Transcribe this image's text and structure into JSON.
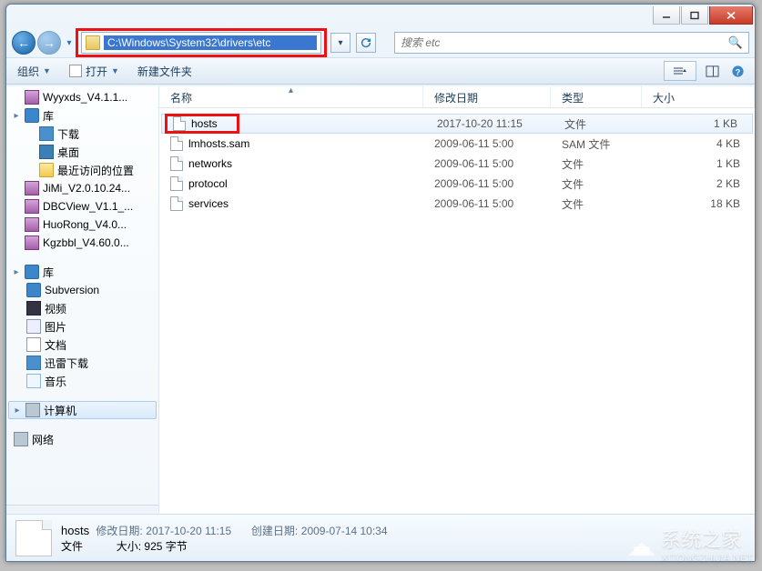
{
  "window": {
    "title": ""
  },
  "nav": {
    "address_path": "C:\\Windows\\System32\\drivers\\etc",
    "search_placeholder": "搜索 etc"
  },
  "toolbar": {
    "organize": "组织",
    "open": "打开",
    "new_folder": "新建文件夹"
  },
  "columns": {
    "name": "名称",
    "date": "修改日期",
    "type": "类型",
    "size": "大小"
  },
  "sidebar": {
    "items": [
      {
        "icon": "archive",
        "label": "Wyyxds_V4.1.1..."
      },
      {
        "icon": "lib",
        "label": "库",
        "twist": "▸"
      },
      {
        "icon": "dl",
        "label": "下载",
        "depth": 1
      },
      {
        "icon": "desktop",
        "label": "桌面",
        "depth": 1
      },
      {
        "icon": "folder",
        "label": "最近访问的位置",
        "depth": 1
      },
      {
        "icon": "archive",
        "label": "JiMi_V2.0.10.24..."
      },
      {
        "icon": "archive",
        "label": "DBCView_V1.1_..."
      },
      {
        "icon": "archive",
        "label": "HuoRong_V4.0..."
      },
      {
        "icon": "archive",
        "label": "Kgzbbl_V4.60.0..."
      }
    ],
    "libraries_header": "库",
    "libraries": [
      {
        "icon": "lib",
        "label": "Subversion"
      },
      {
        "icon": "vid",
        "label": "视频"
      },
      {
        "icon": "pic",
        "label": "图片"
      },
      {
        "icon": "doc",
        "label": "文档"
      },
      {
        "icon": "dl",
        "label": "迅雷下载"
      },
      {
        "icon": "music",
        "label": "音乐"
      }
    ],
    "computer": "计算机",
    "network": "网络"
  },
  "files": [
    {
      "name": "hosts",
      "date": "2017-10-20 11:15",
      "type": "文件",
      "size": "1 KB",
      "selected": true
    },
    {
      "name": "lmhosts.sam",
      "date": "2009-06-11 5:00",
      "type": "SAM 文件",
      "size": "4 KB"
    },
    {
      "name": "networks",
      "date": "2009-06-11 5:00",
      "type": "文件",
      "size": "1 KB"
    },
    {
      "name": "protocol",
      "date": "2009-06-11 5:00",
      "type": "文件",
      "size": "2 KB"
    },
    {
      "name": "services",
      "date": "2009-06-11 5:00",
      "type": "文件",
      "size": "18 KB"
    }
  ],
  "details": {
    "name": "hosts",
    "type": "文件",
    "m_label": "修改日期:",
    "m_value": "2017-10-20 11:15",
    "c_label": "创建日期:",
    "c_value": "2009-07-14 10:34",
    "s_label": "大小:",
    "s_value": "925 字节"
  },
  "watermark": {
    "text": "系统之家",
    "sub": "XITONGZHIJIA.NET"
  }
}
